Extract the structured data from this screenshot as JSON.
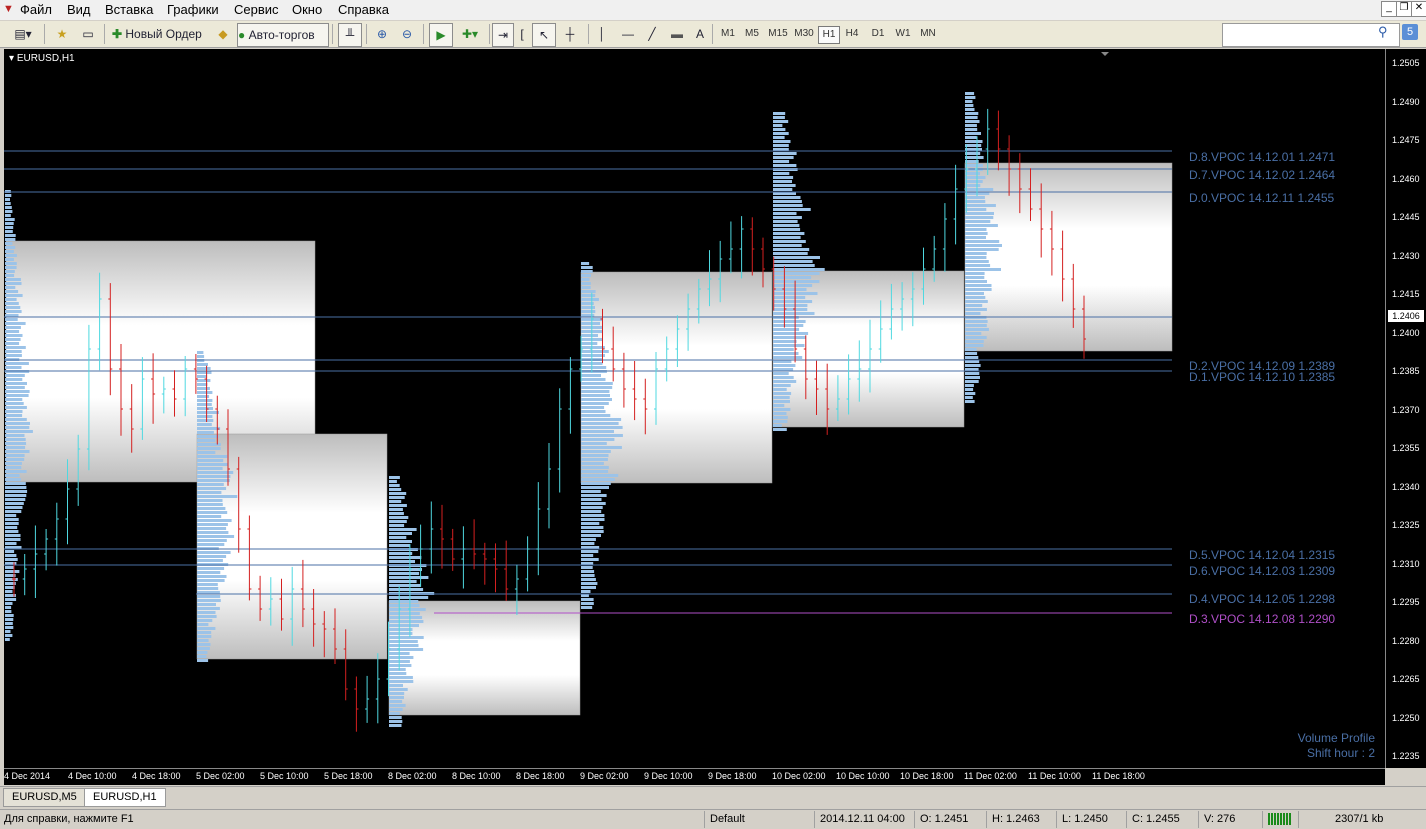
{
  "menu": [
    "Файл",
    "Вид",
    "Вставка",
    "Графики",
    "Сервис",
    "Окно",
    "Справка"
  ],
  "toolbar": {
    "new_order": "Новый Ордер",
    "auto_trading": "Авто-торгов",
    "timeframes": [
      "M1",
      "M5",
      "M15",
      "M30",
      "H1",
      "H4",
      "D1",
      "W1",
      "MN"
    ],
    "active_tf": "H1",
    "notif_count": "5",
    "search_value": ""
  },
  "chart": {
    "symbol": "EURUSD,H1",
    "current_price": "1.2406"
  },
  "price_axis": [
    "1.2505",
    "1.2490",
    "1.2475",
    "1.2460",
    "1.2445",
    "1.2430",
    "1.2415",
    "1.2400",
    "1.2385",
    "1.2370",
    "1.2355",
    "1.2340",
    "1.2325",
    "1.2310",
    "1.2295",
    "1.2280",
    "1.2265",
    "1.2250",
    "1.2235"
  ],
  "time_axis": [
    "4 Dec 2014",
    "4 Dec 10:00",
    "4 Dec 18:00",
    "5 Dec 02:00",
    "5 Dec 10:00",
    "5 Dec 18:00",
    "8 Dec 02:00",
    "8 Dec 10:00",
    "8 Dec 18:00",
    "9 Dec 02:00",
    "9 Dec 10:00",
    "9 Dec 18:00",
    "10 Dec 02:00",
    "10 Dec 10:00",
    "10 Dec 18:00",
    "11 Dec 02:00",
    "11 Dec 10:00",
    "11 Dec 18:00"
  ],
  "vpoc": [
    {
      "text": "D.8.VPOC 14.12.01 1.2471",
      "color": "#4a6fa5"
    },
    {
      "text": "D.7.VPOC 14.12.02 1.2464",
      "color": "#4a6fa5"
    },
    {
      "text": "D.0.VPOC 14.12.11 1.2455",
      "color": "#4a6fa5"
    },
    {
      "text": "D.2.VPOC 14.12.09 1.2389",
      "color": "#4a6fa5"
    },
    {
      "text": "D.1.VPOC 14.12.10 1.2385",
      "color": "#4a6fa5"
    },
    {
      "text": "D.5.VPOC 14.12.04 1.2315",
      "color": "#4a6fa5"
    },
    {
      "text": "D.6.VPOC 14.12.03 1.2309",
      "color": "#4a6fa5"
    },
    {
      "text": "D.4.VPOC 14.12.05 1.2298",
      "color": "#4a6fa5"
    },
    {
      "text": "D.3.VPOC 14.12.08 1.2290",
      "color": "#b04fc8"
    }
  ],
  "indicator": {
    "name": "Volume Profile",
    "shift": "Shift hour : 2"
  },
  "tabs": [
    "EURUSD,M5",
    "EURUSD,H1"
  ],
  "active_tab": "EURUSD,H1",
  "status": {
    "help": "Для справки, нажмите F1",
    "profile": "Default",
    "datetime": "2014.12.11 04:00",
    "open": "O: 1.2451",
    "high": "H: 1.2463",
    "low": "L: 1.2450",
    "close": "C: 1.2455",
    "volume": "V: 276",
    "traffic": "2307/1 kb"
  }
}
